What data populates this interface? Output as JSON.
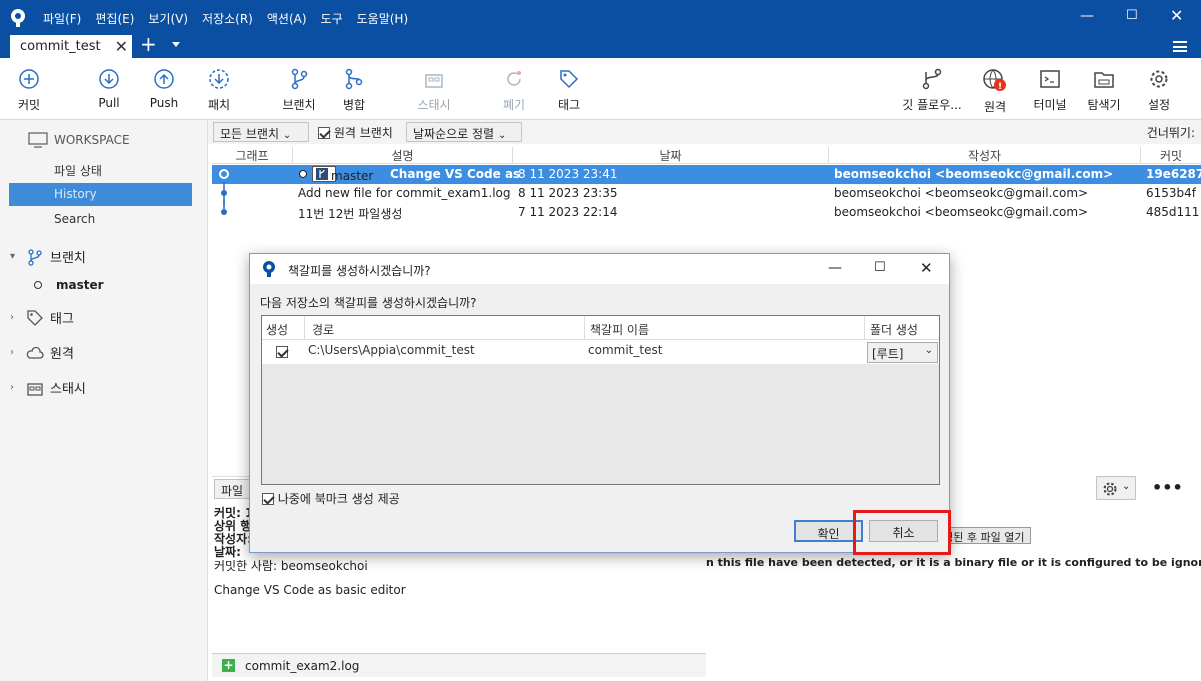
{
  "app": {
    "menu": [
      "파일(F)",
      "편집(E)",
      "보기(V)",
      "저장소(R)",
      "액션(A)",
      "도구",
      "도움말(H)"
    ],
    "tab_label": "commit_test"
  },
  "toolbar": {
    "commit": "커밋",
    "pull": "Pull",
    "push": "Push",
    "fetch": "패치",
    "branch": "브랜치",
    "merge": "병합",
    "stash": "스태시",
    "discard": "폐기",
    "tag": "태그",
    "gitflow": "깃 플로우...",
    "remote": "원격",
    "terminal": "터미널",
    "explorer": "탐색기",
    "settings": "설정"
  },
  "sidebar": {
    "workspace": "WORKSPACE",
    "items": [
      "파일 상태",
      "History",
      "Search"
    ],
    "branches_label": "브랜치",
    "branch_master": "master",
    "tags_label": "태그",
    "remotes_label": "원격",
    "stashes_label": "스태시"
  },
  "filter": {
    "all_branches": "모든 브랜치",
    "remote_branches": "원격 브랜치",
    "sort": "날짜순으로 정렬",
    "skip": "건너뛰기:"
  },
  "table": {
    "headers": [
      "그래프",
      "설명",
      "날짜",
      "작성자",
      "커밋"
    ],
    "rows": [
      {
        "branch": "master",
        "desc": "Change VS Code as",
        "date": "8 11 2023 23:41",
        "author": "beomseokchoi <beomseokc@gmail.com>",
        "commit": "19e6287"
      },
      {
        "desc": "Add new file for commit_exam1.log",
        "date": "8 11 2023 23:35",
        "author": "beomseokchoi <beomseokc@gmail.com>",
        "commit": "6153b4f"
      },
      {
        "desc": "11번 12번 파일생성",
        "date": "7 11 2023 22:14",
        "author": "beomseokchoi <beomseokc@gmail.com>",
        "commit": "485d111"
      }
    ]
  },
  "details": {
    "file_label": "파일",
    "commit_label": "커밋: 1",
    "parent_label": "상위 행",
    "author_label": "작성자:",
    "date_label": "날짜:",
    "committer": "커밋한 사람: beomseokchoi",
    "message": "Change VS Code as basic editor",
    "file": "commit_exam2.log",
    "open_modified": "수정된 후 파일 열기",
    "binary_note": "n this file have been detected, or it is a binary file or it is configured to be ignored by the"
  },
  "dialog": {
    "title": "책갈피를 생성하시겠습니까?",
    "question": "다음 저장소의 책갈피를 생성하시겠습니까?",
    "columns": [
      "생성",
      "경로",
      "책갈피 이름",
      "폴더 생성"
    ],
    "row": {
      "path": "C:\\Users\\Appia\\commit_test",
      "name": "commit_test",
      "folder": "[루트]"
    },
    "later": "나중에 북마크 생성 제공",
    "ok": "확인",
    "cancel": "취소"
  }
}
